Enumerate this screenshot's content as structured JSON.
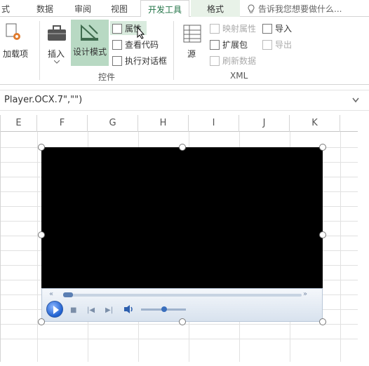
{
  "tabs": {
    "formulas_partial": "式",
    "data": "数据",
    "review": "审阅",
    "view": "视图",
    "developer": "开发工具",
    "format": "格式",
    "tell_me": "告诉我您想要做什么..."
  },
  "ribbon": {
    "addins_label": "加载项",
    "insert_label": "插入",
    "design_mode_label": "设计模式",
    "properties_label": "属性",
    "view_code_label": "查看代码",
    "run_dialog_label": "执行对话框",
    "controls_group": "控件",
    "source_label": "源",
    "map_properties_label": "映射属性",
    "expansion_packs_label": "扩展包",
    "refresh_data_label": "刷新数据",
    "import_label": "导入",
    "export_label": "导出",
    "xml_group": "XML"
  },
  "formula_bar": {
    "text": "Player.OCX.7\",\"\")"
  },
  "columns": [
    "E",
    "F",
    "G",
    "H",
    "I",
    "J",
    "K"
  ],
  "colors": {
    "accent": "#217346",
    "design_mode_active": "#b8d9c3",
    "player_bg": "#000000"
  },
  "player": {
    "seek_position": 0.03,
    "volume_level": 0.5
  }
}
